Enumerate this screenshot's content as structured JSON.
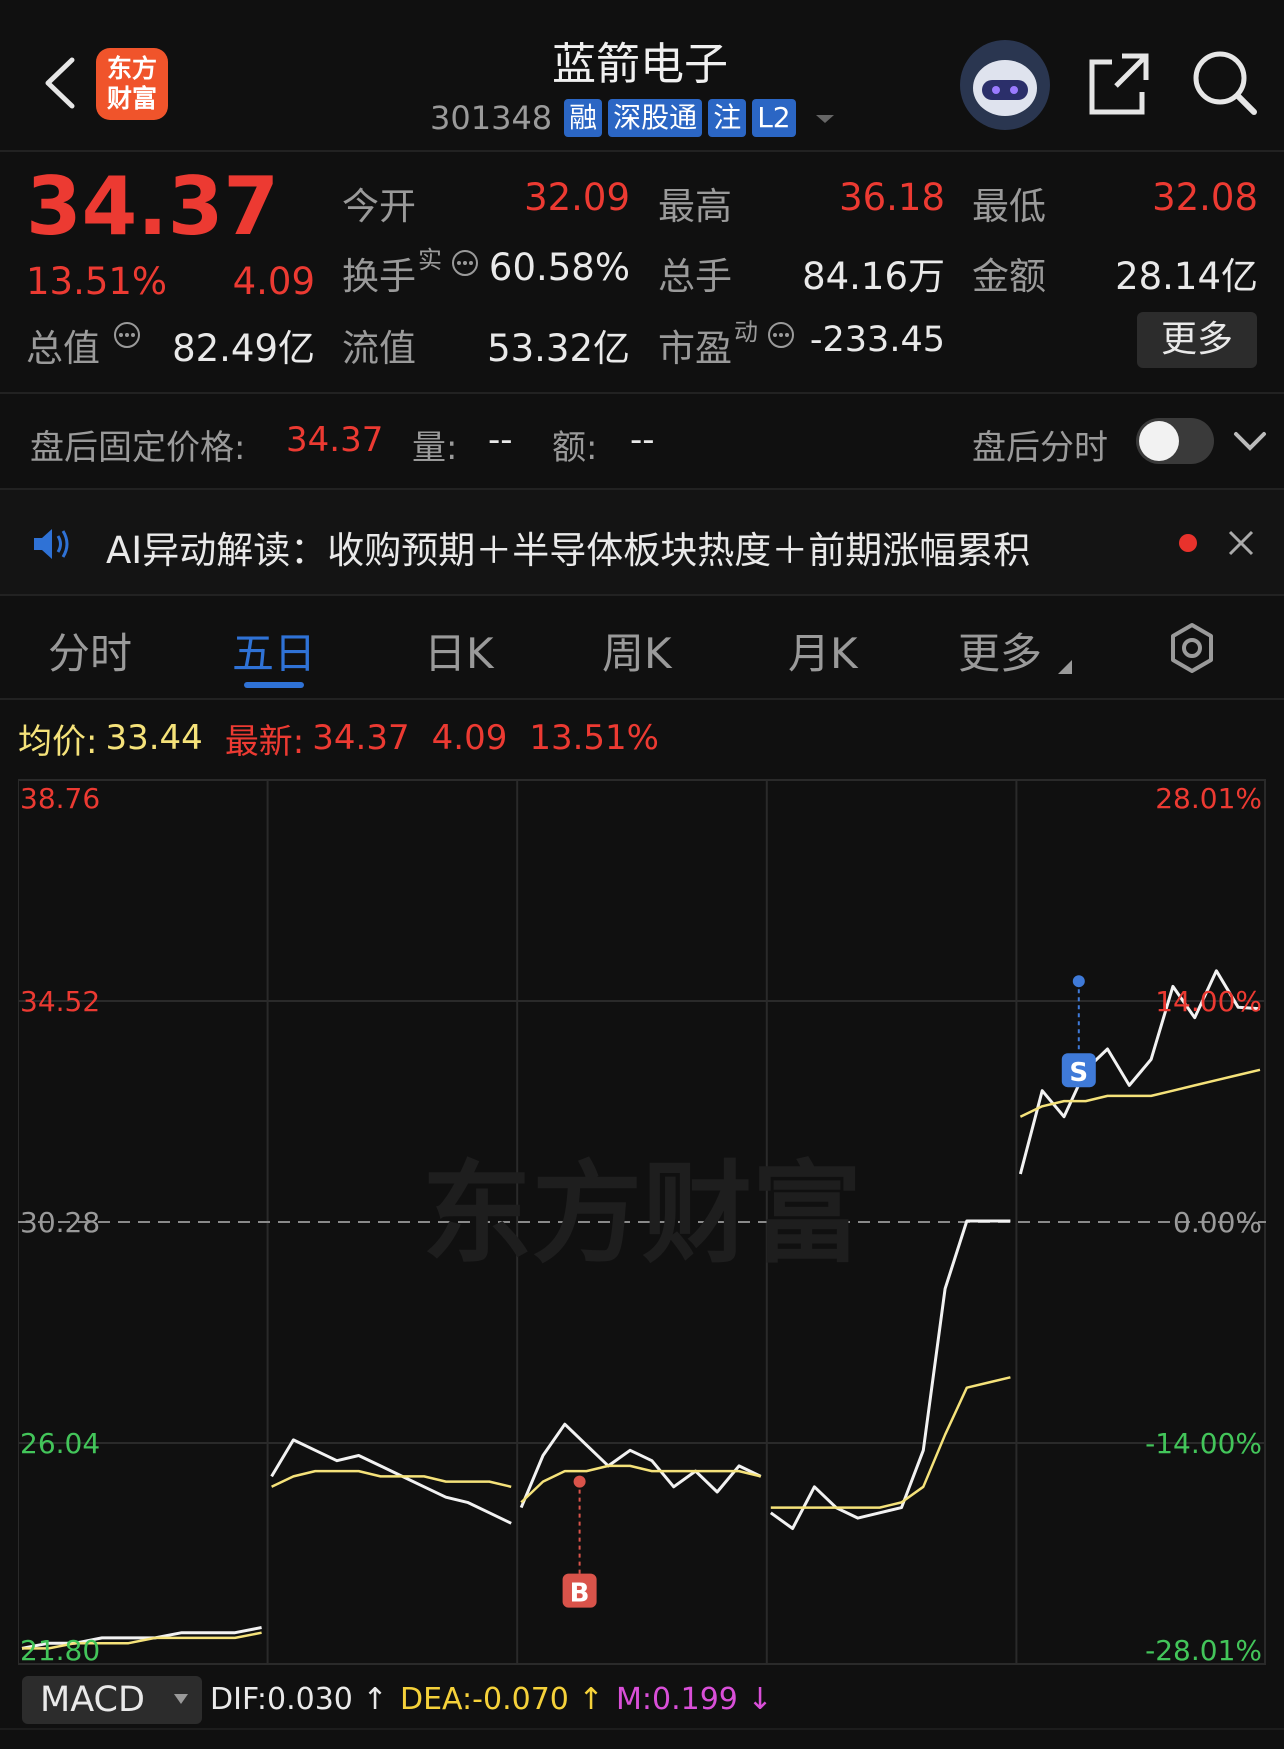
{
  "header": {
    "back_icon": "chevron-left-icon",
    "logo_text": "东方财富",
    "stock_name": "蓝箭电子",
    "stock_code": "301348",
    "tags": [
      "融",
      "深股通",
      "注",
      "L2"
    ],
    "robot_icon": "robot-avatar-icon",
    "share_icon": "share-icon",
    "search_icon": "search-icon"
  },
  "quote": {
    "price": "34.37",
    "change_pct": "13.51%",
    "change_amt": "4.09",
    "open_label": "今开",
    "open": "32.09",
    "high_label": "最高",
    "high": "36.18",
    "low_label": "最低",
    "low": "32.08",
    "turnover_label": "换手",
    "turnover_sup": "实",
    "turnover": "60.58%",
    "volume_label": "总手",
    "volume": "84.16万",
    "amount_label": "金额",
    "amount": "28.14亿",
    "mcap_label": "总值",
    "mcap": "82.49亿",
    "float_label": "流值",
    "float": "53.32亿",
    "pe_label": "市盈",
    "pe_sup": "动",
    "pe": "-233.45",
    "more_label": "更多"
  },
  "after_hours": {
    "price_label": "盘后固定价格:",
    "price": "34.37",
    "vol_label": "量:",
    "vol": "--",
    "amt_label": "额:",
    "amt": "--",
    "toggle_label": "盘后分时",
    "toggle_on": false
  },
  "ai_banner": {
    "text": "AI异动解读：收购预期＋半导体板块热度＋前期涨幅累积"
  },
  "tabs": [
    "分时",
    "五日",
    "日K",
    "周K",
    "月K",
    "更多"
  ],
  "active_tab": 1,
  "chart_info": {
    "avg_label": "均价:",
    "avg": "33.44",
    "latest_label": "最新:",
    "latest": "34.37",
    "latest_chg": "4.09",
    "latest_pct": "13.51%"
  },
  "chart_data": {
    "type": "line",
    "y_left_ticks": [
      "38.76",
      "34.52",
      "30.28",
      "26.04",
      "21.80"
    ],
    "y_right_ticks": [
      "28.01%",
      "14.00%",
      "0.00%",
      "-14.00%",
      "-28.01%"
    ],
    "ylim": [
      21.8,
      38.76
    ],
    "prev_close": 30.28,
    "watermark": "东方财富",
    "days": 5,
    "series": [
      {
        "values": [
          [
            22.1,
            22.2,
            22.2,
            22.3,
            22.3,
            22.3,
            22.4,
            22.4,
            22.4,
            22.5
          ],
          [
            25.4,
            26.1,
            25.9,
            25.7,
            25.8,
            25.6,
            25.4,
            25.2,
            25.0,
            24.9,
            24.7,
            24.5
          ],
          [
            24.8,
            25.8,
            26.4,
            26.0,
            25.6,
            25.9,
            25.7,
            25.2,
            25.5,
            25.1,
            25.6,
            25.4
          ],
          [
            24.7,
            24.4,
            25.2,
            24.8,
            24.6,
            24.7,
            24.8,
            25.9,
            29.0,
            30.3,
            30.3,
            30.3
          ],
          [
            31.2,
            32.8,
            32.3,
            33.2,
            33.6,
            32.9,
            33.4,
            34.8,
            34.2,
            35.1,
            34.4,
            34.37
          ]
        ]
      },
      {
        "values": [
          [
            22.1,
            22.1,
            22.2,
            22.2,
            22.2,
            22.3,
            22.3,
            22.3,
            22.3,
            22.4
          ],
          [
            25.2,
            25.4,
            25.5,
            25.5,
            25.5,
            25.4,
            25.4,
            25.4,
            25.3,
            25.3,
            25.3,
            25.2
          ],
          [
            24.9,
            25.3,
            25.5,
            25.5,
            25.6,
            25.6,
            25.5,
            25.5,
            25.5,
            25.5,
            25.5,
            25.4
          ],
          [
            24.8,
            24.8,
            24.8,
            24.8,
            24.8,
            24.8,
            24.9,
            25.2,
            26.2,
            27.1,
            27.2,
            27.3
          ],
          [
            32.3,
            32.5,
            32.6,
            32.6,
            32.7,
            32.7,
            32.7,
            32.8,
            32.9,
            33.0,
            33.1,
            33.2
          ]
        ]
      }
    ],
    "markers": [
      {
        "label": "B",
        "day": 2,
        "value": 25.3
      },
      {
        "label": "S",
        "day": 4,
        "value": 34.9
      }
    ]
  },
  "indicator": {
    "name": "MACD",
    "dif": "DIF:0.030 ↑",
    "dea": "DEA:-0.070 ↑",
    "m": "M:0.199 ↓"
  },
  "colors": {
    "up": "#ec3a32",
    "down": "#43c55a",
    "accent": "#2f72d6",
    "avg_line": "#f5e27a",
    "dea": "#f5d13a",
    "m": "#d94fd8"
  }
}
